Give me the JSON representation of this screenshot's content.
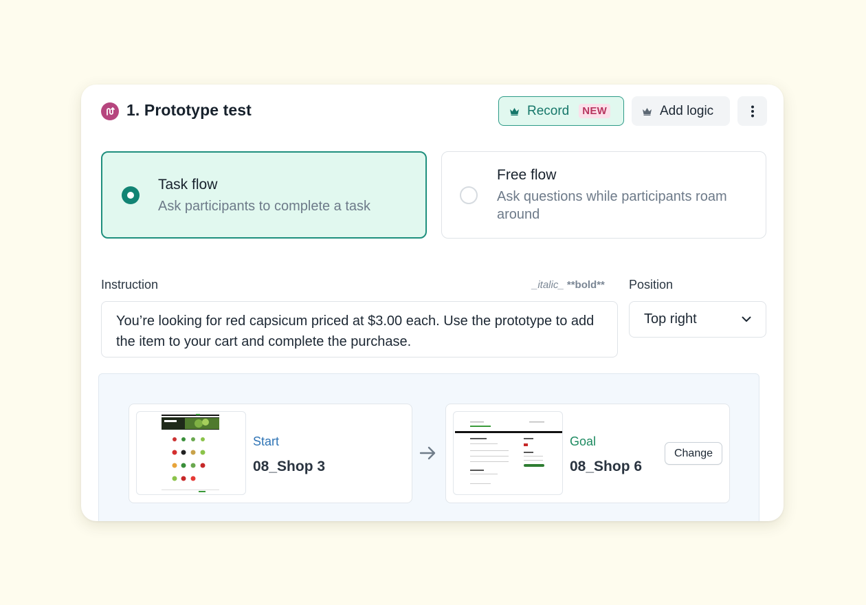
{
  "header": {
    "title": "1. Prototype test",
    "record_label": "Record",
    "new_badge": "NEW",
    "add_logic_label": "Add logic"
  },
  "flow_options": [
    {
      "title": "Task flow",
      "description": "Ask participants to complete a task",
      "selected": true
    },
    {
      "title": "Free flow",
      "description": "Ask questions while participants roam around",
      "selected": false
    }
  ],
  "instruction": {
    "label": "Instruction",
    "format_hint_italic": "_italic_",
    "format_hint_bold": "**bold**",
    "value": "You’re looking for red capsicum priced at $3.00 each. Use the prototype to add the item to your cart and complete the purchase."
  },
  "position": {
    "label": "Position",
    "value": "Top right"
  },
  "screens": {
    "start": {
      "kind": "Start",
      "name": "08_Shop 3"
    },
    "goal": {
      "kind": "Goal",
      "name": "08_Shop 6",
      "change_label": "Change"
    }
  },
  "colors": {
    "accent": "#128474",
    "selected_bg": "#e1f8ef",
    "brand_icon": "#b6457e",
    "new_badge": "#b7355f",
    "background": "#fefcee"
  }
}
